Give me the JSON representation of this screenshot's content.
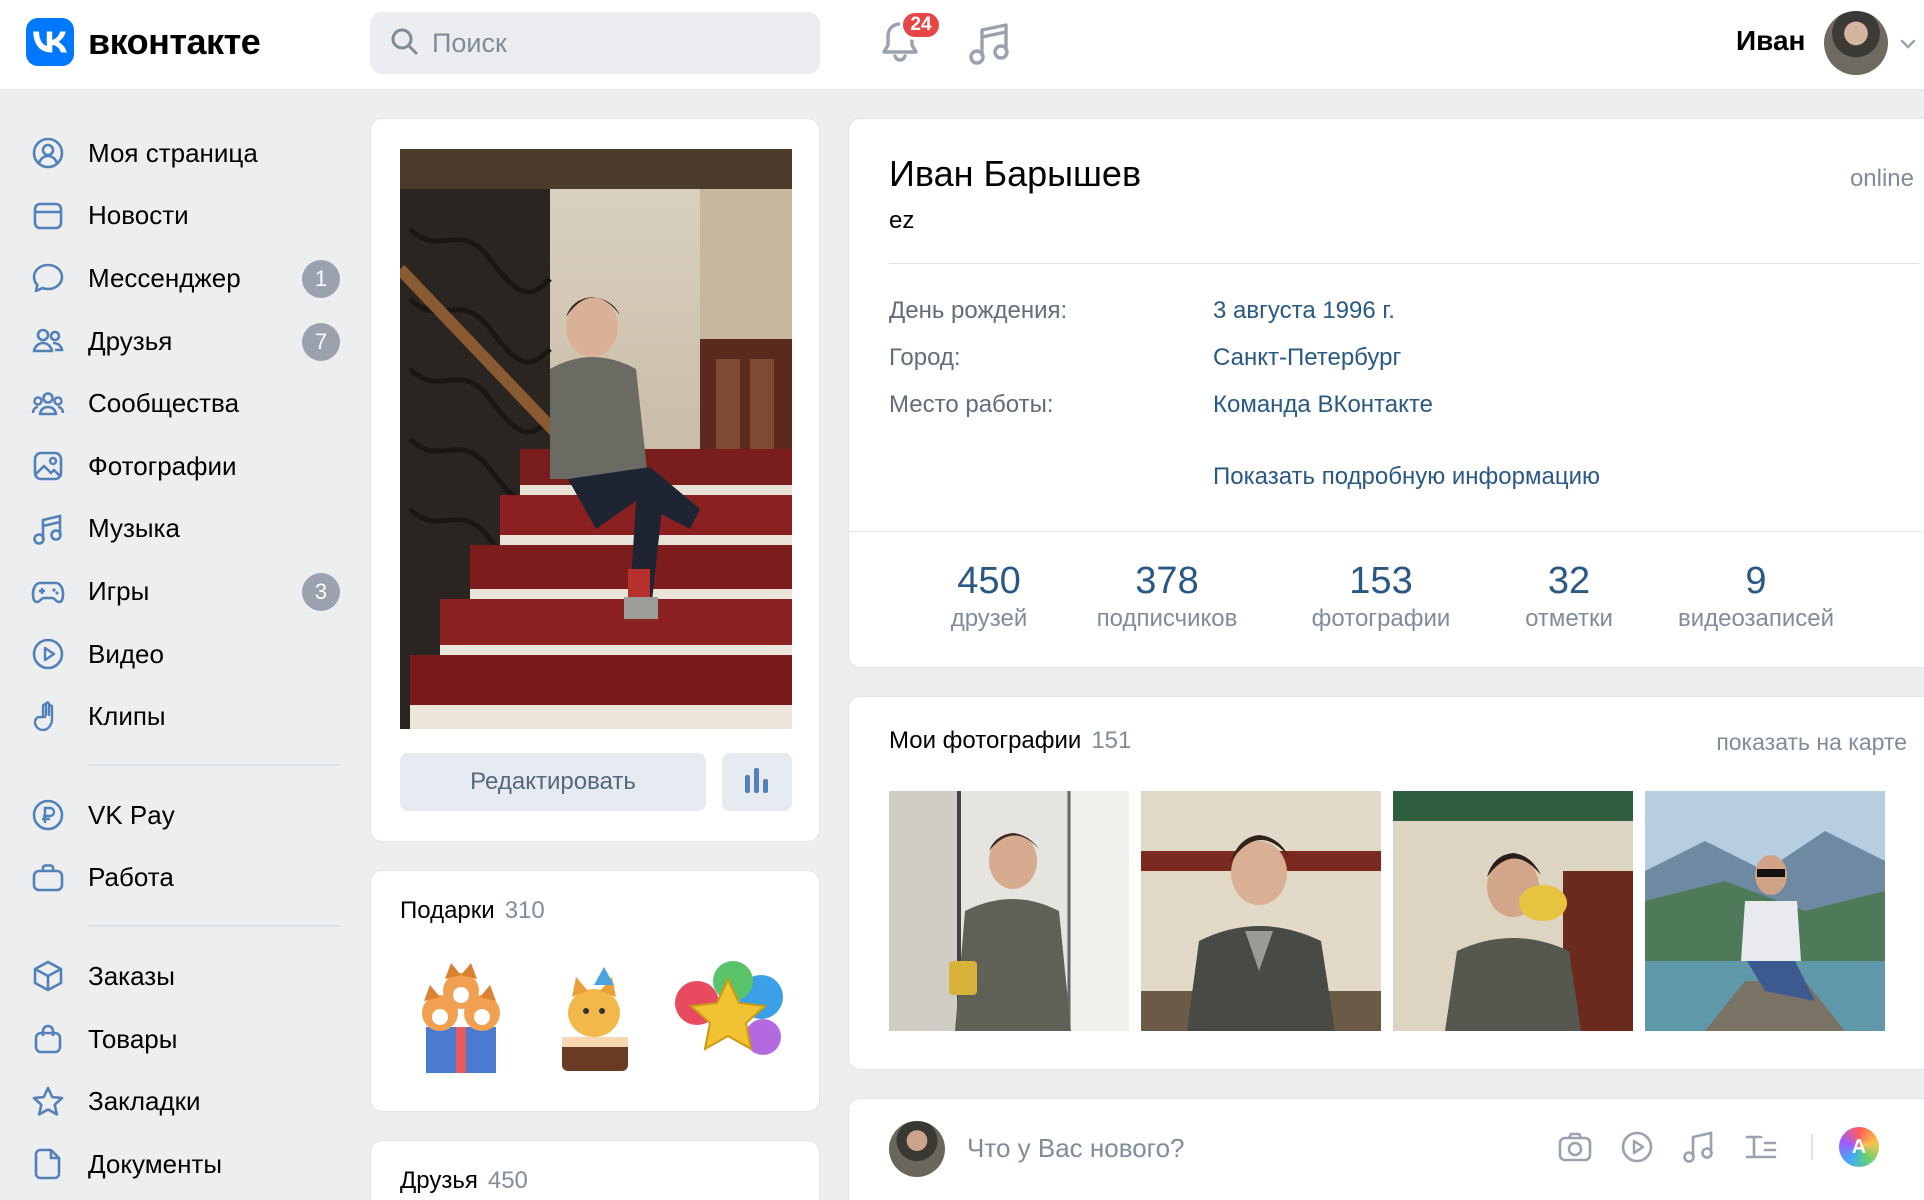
{
  "header": {
    "logo_text": "вконтакте",
    "search_placeholder": "Поиск",
    "notifications_count": "24",
    "user_name": "Иван"
  },
  "sidebar": {
    "items": [
      {
        "label": "Моя страница",
        "icon": "user-circle-icon"
      },
      {
        "label": "Новости",
        "icon": "news-icon"
      },
      {
        "label": "Мессенджер",
        "icon": "message-icon",
        "badge": "1"
      },
      {
        "label": "Друзья",
        "icon": "friends-icon",
        "badge": "7"
      },
      {
        "label": "Сообщества",
        "icon": "communities-icon"
      },
      {
        "label": "Фотографии",
        "icon": "photo-icon"
      },
      {
        "label": "Музыка",
        "icon": "music-icon"
      },
      {
        "label": "Игры",
        "icon": "gamepad-icon",
        "badge": "3"
      },
      {
        "label": "Видео",
        "icon": "video-icon"
      },
      {
        "label": "Клипы",
        "icon": "clips-icon"
      }
    ],
    "items2": [
      {
        "label": "VK Pay",
        "icon": "vkpay-icon"
      },
      {
        "label": "Работа",
        "icon": "briefcase-icon"
      }
    ],
    "items3": [
      {
        "label": "Заказы",
        "icon": "box-icon"
      },
      {
        "label": "Товары",
        "icon": "bag-icon"
      },
      {
        "label": "Закладки",
        "icon": "star-icon"
      },
      {
        "label": "Документы",
        "icon": "document-icon"
      }
    ]
  },
  "photo_card": {
    "edit_label": "Редактировать"
  },
  "gifts": {
    "title": "Подарки",
    "count": "310"
  },
  "friends_block": {
    "title": "Друзья",
    "count": "450"
  },
  "profile": {
    "name": "Иван Барышев",
    "status": "ez",
    "online": "online",
    "info": [
      {
        "label": "День рождения:",
        "value": "3 августа 1996 г."
      },
      {
        "label": "Город:",
        "value": "Санкт-Петербург"
      },
      {
        "label": "Место работы:",
        "value": "Команда ВКонтакте"
      }
    ],
    "more_link": "Показать подробную информацию",
    "counters": [
      {
        "num": "450",
        "label": "друзей"
      },
      {
        "num": "378",
        "label": "подписчиков"
      },
      {
        "num": "153",
        "label": "фотографии"
      },
      {
        "num": "32",
        "label": "отметки"
      },
      {
        "num": "9",
        "label": "видеозаписей"
      }
    ]
  },
  "photos": {
    "title": "Мои фотографии",
    "count": "151",
    "map_link": "показать на карте"
  },
  "post": {
    "placeholder": "Что у Вас нового?",
    "avatar_letter": "A"
  },
  "colors": {
    "accent": "#0077ff",
    "link": "#2a5885",
    "badge": "#e64646",
    "secondary": "#818c99"
  }
}
